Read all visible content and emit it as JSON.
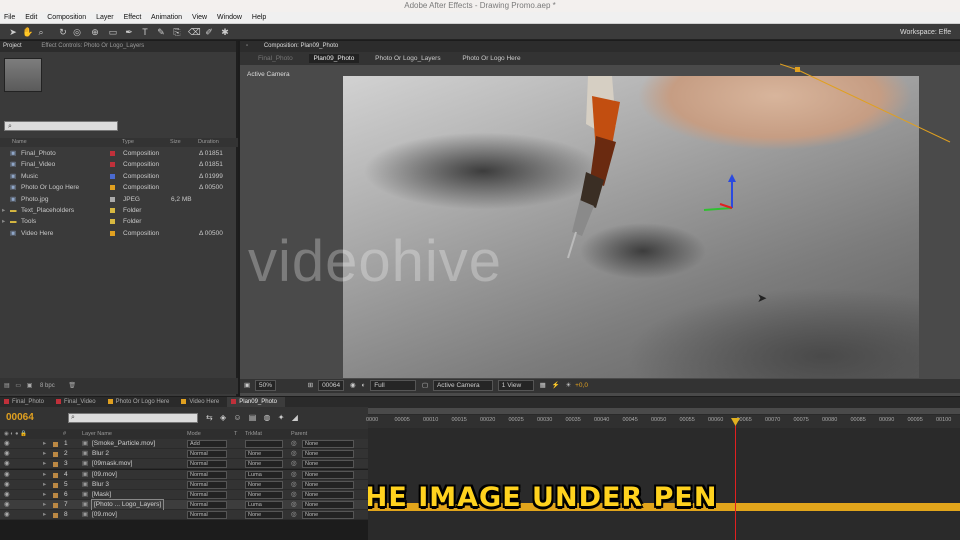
{
  "window_title": "Adobe After Effects - Drawing Promo.aep *",
  "menu": [
    "File",
    "Edit",
    "Composition",
    "Layer",
    "Effect",
    "Animation",
    "View",
    "Window",
    "Help"
  ],
  "workspace_label": "Workspace:",
  "workspace_value": "Effe",
  "project_panel": {
    "tabs": [
      "Project",
      "Effect Controls: Photo Or Logo_Layers"
    ],
    "columns": [
      "Name",
      "Type",
      "Size",
      "Duration"
    ],
    "items": [
      {
        "name": "Final_Photo",
        "type": "Composition",
        "size": "",
        "duration": "Δ 01851",
        "color": "#c0303a"
      },
      {
        "name": "Final_Video",
        "type": "Composition",
        "size": "",
        "duration": "Δ 01851",
        "color": "#c0303a"
      },
      {
        "name": "Music",
        "type": "Composition",
        "size": "",
        "duration": "Δ 01999",
        "color": "#4a6ad0"
      },
      {
        "name": "Photo Or Logo Here",
        "type": "Composition",
        "size": "",
        "duration": "Δ 00500",
        "color": "#e0a020"
      },
      {
        "name": "Photo.jpg",
        "type": "JPEG",
        "size": "6,2 MB",
        "duration": "",
        "color": "#aaaaaa"
      },
      {
        "name": "Text_Placeholders",
        "type": "Folder",
        "size": "",
        "duration": "",
        "color": "#d7b840"
      },
      {
        "name": "Tools",
        "type": "Folder",
        "size": "",
        "duration": "",
        "color": "#d7b840"
      },
      {
        "name": "Video Here",
        "type": "Composition",
        "size": "",
        "duration": "Δ 00500",
        "color": "#e0a020"
      }
    ],
    "bpc": "8 bpc"
  },
  "composition_panel": {
    "tab": "Composition: Plan09_Photo",
    "flow": [
      "Final_Photo",
      "Plan09_Photo",
      "Photo Or Logo_Layers",
      "Photo Or Logo Here"
    ],
    "view_label": "Active Camera",
    "watermark": "videohive",
    "footer": {
      "zoom": "50%",
      "timecode": "00064",
      "resolution": "Full",
      "camera": "Active Camera",
      "views": "1 View",
      "exposure": "+0,0"
    }
  },
  "timeline": {
    "tabs": [
      {
        "label": "Final_Photo",
        "color": "#c0303a"
      },
      {
        "label": "Final_Video",
        "color": "#c0303a"
      },
      {
        "label": "Photo Or Logo Here",
        "color": "#e0a020"
      },
      {
        "label": "Video Here",
        "color": "#e0a020"
      },
      {
        "label": "Plan09_Photo",
        "color": "#c0303a"
      }
    ],
    "current_time": "00064",
    "columns": [
      "#",
      "Layer Name",
      "Mode",
      "T",
      "TrkMat",
      "Parent"
    ],
    "layers": [
      {
        "num": "1",
        "name": "[Smoke_Particle.mov]",
        "mode": "Add",
        "trkmat": "",
        "parent": "None"
      },
      {
        "num": "2",
        "name": "Blur 2",
        "mode": "Normal",
        "trkmat": "None",
        "parent": "None"
      },
      {
        "num": "3",
        "name": "[09mask.mov]",
        "mode": "Normal",
        "trkmat": "None",
        "parent": "None"
      },
      {
        "num": "4",
        "name": "[09.mov]",
        "mode": "Normal",
        "trkmat": "Luma",
        "parent": "None"
      },
      {
        "num": "5",
        "name": "Blur 3",
        "mode": "Normal",
        "trkmat": "None",
        "parent": "None"
      },
      {
        "num": "6",
        "name": "[Mask]",
        "mode": "Normal",
        "trkmat": "None",
        "parent": "None"
      },
      {
        "num": "7",
        "name": "[Photo ... Logo_Layers]",
        "mode": "Normal",
        "trkmat": "Luma",
        "parent": "None"
      },
      {
        "num": "8",
        "name": "[09.mov]",
        "mode": "Normal",
        "trkmat": "None",
        "parent": "None"
      }
    ],
    "ruler_ticks": [
      "0000",
      "00005",
      "00010",
      "00015",
      "00020",
      "00025",
      "00030",
      "00035",
      "00040",
      "00045",
      "00050",
      "00055",
      "00060",
      "00065",
      "00070",
      "00075",
      "00080",
      "00085",
      "00090",
      "00095",
      "00100"
    ]
  },
  "subtitle": "MOVE THE IMAGE UNDER PEN"
}
